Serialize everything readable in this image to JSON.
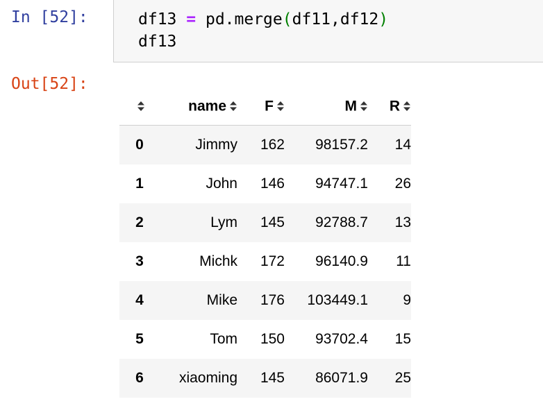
{
  "input_prompt": "In [52]:",
  "output_prompt": "Out[52]:",
  "code": {
    "line1": {
      "var": "df13",
      "op": "=",
      "call": "pd.merge",
      "open": "(",
      "args": "df11,df12",
      "close": ")"
    },
    "line2": "df13"
  },
  "table": {
    "columns": [
      "name",
      "F",
      "M",
      "R"
    ],
    "rows": [
      {
        "index": "0",
        "name": "Jimmy",
        "F": "162",
        "M": "98157.2",
        "R": "14"
      },
      {
        "index": "1",
        "name": "John",
        "F": "146",
        "M": "94747.1",
        "R": "26"
      },
      {
        "index": "2",
        "name": "Lym",
        "F": "145",
        "M": "92788.7",
        "R": "13"
      },
      {
        "index": "3",
        "name": "Michk",
        "F": "172",
        "M": "96140.9",
        "R": "11"
      },
      {
        "index": "4",
        "name": "Mike",
        "F": "176",
        "M": "103449.1",
        "R": "9"
      },
      {
        "index": "5",
        "name": "Tom",
        "F": "150",
        "M": "93702.4",
        "R": "15"
      },
      {
        "index": "6",
        "name": "xiaoming",
        "F": "145",
        "M": "86071.9",
        "R": "25"
      }
    ]
  },
  "icons": {
    "sort": "sort-arrows-icon"
  },
  "colors": {
    "in_prompt": "#303f9f",
    "out_prompt": "#d84315",
    "operator": "#aa22ff",
    "parenthesis": "#008000",
    "cell_bg": "#f7f7f7",
    "row_stripe": "#f5f5f5"
  }
}
